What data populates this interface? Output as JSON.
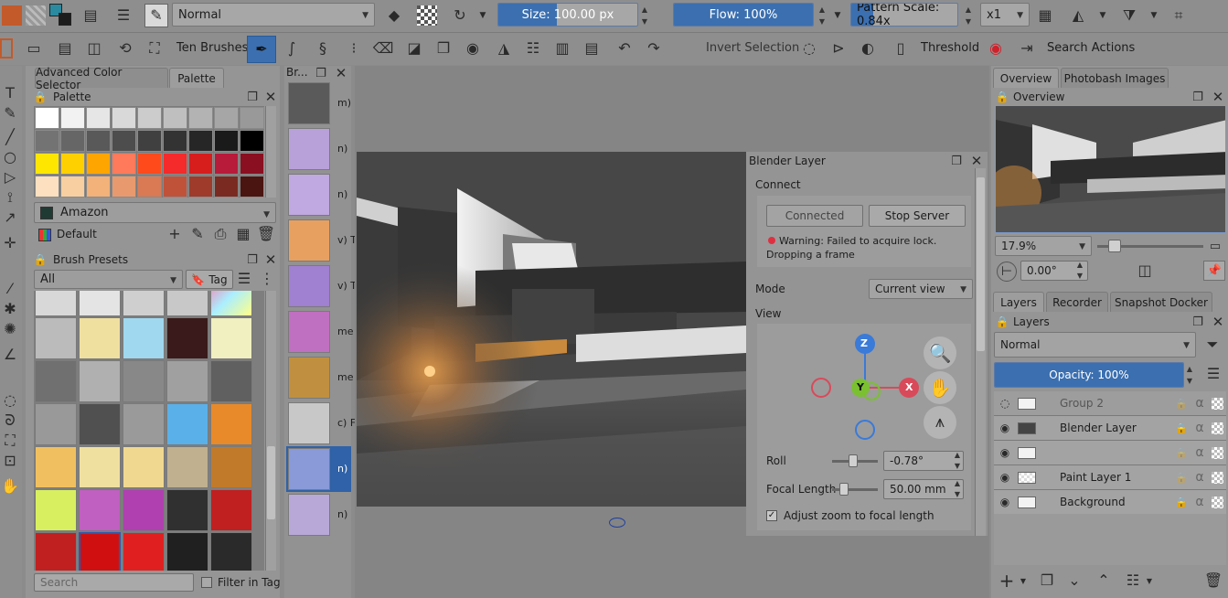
{
  "toolbar": {
    "blend_mode": "Normal",
    "size_label": "Size: 100.00 px",
    "size_fraction": 0.42,
    "flow_label": "Flow: 100%",
    "flow_fraction": 1.0,
    "pattern_label": "Pattern Scale: 0.84x",
    "pattern_fraction": 0.21,
    "multiplier": "x1"
  },
  "toolbar2": {
    "ten_brushes": "Ten Brushes",
    "invert_selection": "Invert Selection",
    "threshold": "Threshold",
    "search_actions": "Search Actions"
  },
  "left_dock": {
    "tabs": [
      "Advanced Color Selector",
      "Palette"
    ],
    "palette_title": "Palette",
    "palette_rows": [
      [
        "#ffffff",
        "#f2f2f2",
        "#e6e6e6",
        "#d9d9d9",
        "#cccccc",
        "#bfbfbf",
        "#b3b3b3",
        "#a6a6a6",
        "#999999"
      ],
      [
        "#737373",
        "#666666",
        "#595959",
        "#4d4d4d",
        "#404040",
        "#333333",
        "#262626",
        "#1a1a1a",
        "#000000"
      ],
      [
        "#ffe600",
        "#ffd000",
        "#ffa500",
        "#ff7a5a",
        "#ff4a1c",
        "#f52a2a",
        "#d81d1d",
        "#b81a3a",
        "#8a0f20"
      ],
      [
        "#fde0c0",
        "#f7cfa0",
        "#f2b27a",
        "#e89a6e",
        "#d97a55",
        "#c0523a",
        "#9e3b2a",
        "#7a2a20",
        "#4a1410"
      ]
    ],
    "palette_name": "Amazon",
    "palette_default": "Default",
    "brush_presets_title": "Brush Presets",
    "filter_all": "All",
    "tag_label": "Tag",
    "search_placeholder": "Search",
    "filter_in_tag": "Filter in Tag"
  },
  "brush_strip": {
    "title": "Br...",
    "labels": [
      "m)",
      "n)",
      "n)",
      "v) T",
      "v) T",
      "me",
      "me",
      "c) F",
      "n)",
      "n)"
    ]
  },
  "blender_layer": {
    "title": "Blender Layer",
    "connect_label": "Connect",
    "connected_button": "Connected",
    "stop_server_button": "Stop Server",
    "warning_text": "Warning: Failed to acquire lock. Dropping a frame",
    "mode_label": "Mode",
    "mode_value": "Current view",
    "view_label": "View",
    "axis_z": "Z",
    "axis_y": "Y",
    "axis_x": "X",
    "roll_label": "Roll",
    "roll_value": "-0.78°",
    "focal_label": "Focal Length",
    "focal_value": "50.00 mm",
    "adjust_zoom_label": "Adjust zoom to focal length"
  },
  "right_dock": {
    "top_tabs": [
      "Overview",
      "Photobash Images"
    ],
    "overview_title": "Overview",
    "zoom_value": "17.9%",
    "rotation_value": "0.00°",
    "layer_tabs": [
      "Layers",
      "Recorder",
      "Snapshot Docker"
    ],
    "layers_title": "Layers",
    "layer_blend_mode": "Normal",
    "opacity_label": "Opacity:  100%",
    "layers": [
      {
        "name": "Group 2",
        "dim": true
      },
      {
        "name": "Blender Layer",
        "dim": false
      },
      {
        "name": "",
        "dim": false
      },
      {
        "name": "Paint Layer 1",
        "dim": false
      },
      {
        "name": "Background",
        "dim": false
      }
    ]
  },
  "colors": {
    "accent": "#3b6fb0",
    "panel": "#959595",
    "toolbar": "#8e8e8e"
  }
}
